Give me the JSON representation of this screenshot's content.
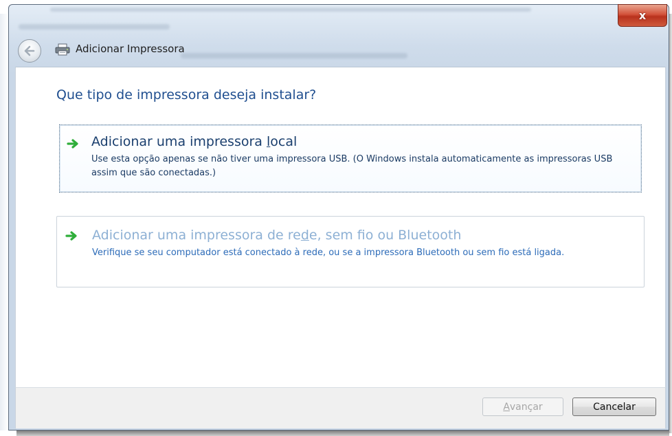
{
  "window": {
    "title": "Adicionar Impressora",
    "close_symbol": "x",
    "back_icon": "back-arrow-icon",
    "title_icon": "printer-icon"
  },
  "main": {
    "heading": "Que tipo de impressora deseja instalar?",
    "options": [
      {
        "icon": "green-arrow-icon",
        "title_before": "Adicionar uma impressora ",
        "title_accel": "l",
        "title_after": "ocal",
        "description": "Use esta opção apenas se não tiver uma impressora USB. (O Windows instala automaticamente as impressoras USB assim que são conectadas.)",
        "selected": true
      },
      {
        "icon": "green-arrow-icon",
        "title_before": "Adicionar uma impressora de re",
        "title_accel": "d",
        "title_after": "e, sem fio ou Bluetooth",
        "description": "Verifique se seu computador está conectado à rede, ou se a impressora Bluetooth ou sem fio está ligada.",
        "selected": false
      }
    ]
  },
  "footer": {
    "next": {
      "accel": "A",
      "rest": "vançar",
      "enabled": false
    },
    "cancel": {
      "label": "Cancelar",
      "enabled": true
    }
  },
  "colors": {
    "heading": "#1f4e8f",
    "option_local_title": "#1a3f6e",
    "option_local_desc": "#1a3a63",
    "option_network_title": "#8db0d4",
    "option_network_desc": "#2c6bb8",
    "arrow_green": "#2fae3a"
  }
}
